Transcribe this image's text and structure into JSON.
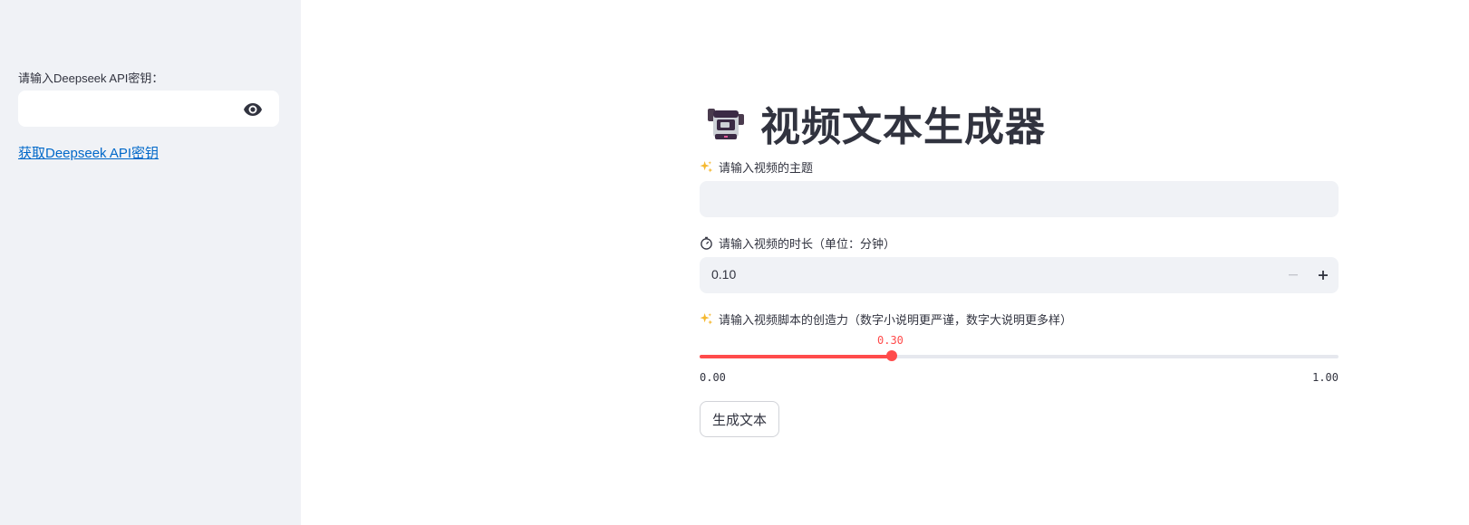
{
  "sidebar": {
    "api_key_label": "请输入Deepseek API密钥：",
    "api_key_value": "",
    "get_key_link": "获取Deepseek API密钥"
  },
  "main": {
    "title": "视频文本生成器",
    "title_icon": "video-camera-icon",
    "subject_label": "请输入视频的主题",
    "subject_value": "",
    "duration_label": "请输入视频的时长（单位：分钟）",
    "duration_value": "0.10",
    "creativity_label": "请输入视频脚本的创造力（数字小说明更严谨，数字大说明更多样）",
    "creativity_value": "0.30",
    "creativity_level": 0.3,
    "creativity_min": "0.00",
    "creativity_max": "1.00",
    "generate_button": "生成文本"
  },
  "colors": {
    "accent": "#ff4b4b",
    "link": "#0068c9",
    "sidebar_bg": "#f0f2f6",
    "input_bg": "#f0f2f6"
  }
}
